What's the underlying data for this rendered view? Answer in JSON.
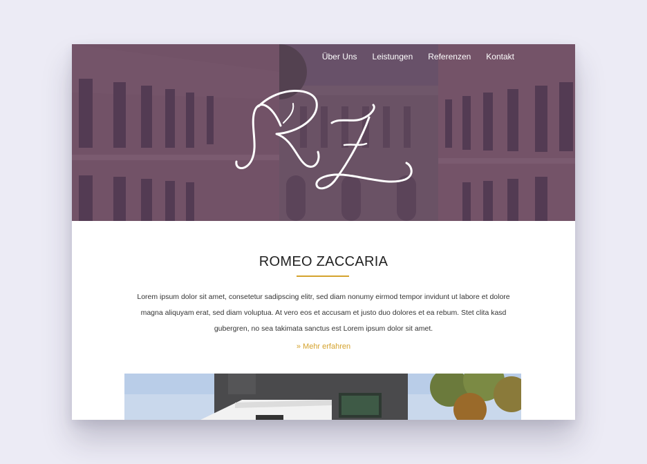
{
  "nav": {
    "items": [
      {
        "label": "Über Uns"
      },
      {
        "label": "Leistungen"
      },
      {
        "label": "Referenzen"
      },
      {
        "label": "Kontakt"
      }
    ]
  },
  "logo": {
    "monogram": "RZ"
  },
  "intro": {
    "title": "ROMEO ZACCARIA",
    "text": "Lorem ipsum dolor sit amet, consetetur sadipscing elitr, sed diam nonumy eirmod tempor invidunt ut labore et dolore magna aliquyam erat, sed diam voluptua. At vero eos et accusam et justo duo dolores et ea rebum. Stet clita kasd gubergren, no sea takimata sanctus est Lorem ipsum dolor sit amet.",
    "more_link": "» Mehr erfahren"
  },
  "colors": {
    "accent": "#d4a22c",
    "hero_overlay": "#4c2e52",
    "background": "#ecebf5"
  }
}
